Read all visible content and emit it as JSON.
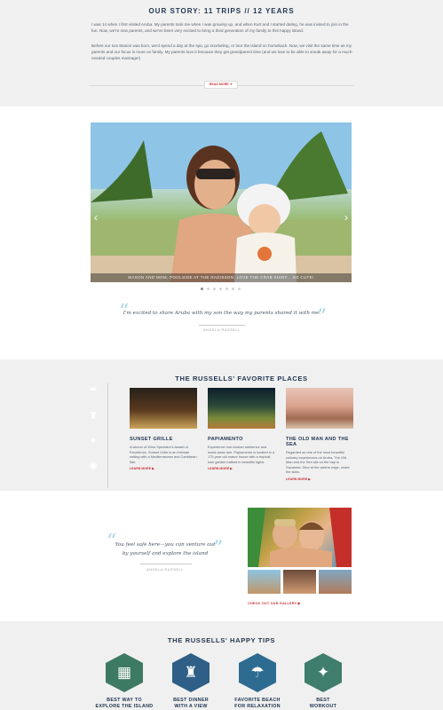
{
  "story": {
    "title": "OUR STORY:  11 TRIPS // 12 YEARS",
    "para1": "I was 14 when I first visited Aruba. My parents took me when I was growing up, and when Kurt and I started dating, he was invited to join in the fun. Now, we're new parents, and we've been very excited to bring a third generation of my family to this happy island.",
    "para2": "Before our son Mason was born, we'd spend a day at the spa, go snorkeling, or tour the island on horseback. Now, we visit the same time as my parents and our focus is more on family. My parents love it because they get grandparent time (and we love to be able to sneak away for a much-needed couples massage!)",
    "read_more": "READ MORE ▼"
  },
  "gallery": {
    "caption": "MASON AND MOM, POOLSIDE AT THE RADISSON. LOVE THE CRAB SHIRT... SO CUTE!",
    "prev_icon": "‹",
    "next_icon": "›",
    "dot_count": 7,
    "active_dot": 0,
    "quote": "I'm excited to share Aruba with my son the way my parents shared it with me.",
    "attribution": "ANGELA RUSSELL"
  },
  "places": {
    "title": "THE RUSSELLS' FAVORITE PLACES",
    "icons": [
      {
        "name": "beach-umbrella-icon",
        "glyph": "☂",
        "color": "#2f6fa3"
      },
      {
        "name": "waiter-icon",
        "glyph": "♜",
        "color": "#6f8fa3"
      },
      {
        "name": "swimmer-icon",
        "glyph": "✶",
        "color": "#4f86b2"
      },
      {
        "name": "sunglasses-icon",
        "glyph": "◉",
        "color": "#7aa39a"
      }
    ],
    "cards": [
      {
        "title": "SUNSET GRILLE",
        "text": "A winner of Wine Spectator's Award of Excellence, Sunset Grille is an intimate setting with a Mediterranean and Caribbean flair.",
        "link": "LEARN MORE ▶"
      },
      {
        "title": "PAPIAMENTO",
        "text": "Experience true Aruban ambience and world-class fare.  Papiamento is located in a 175-year old manor house with a tropical, lush garden bathed in beautiful lights.",
        "link": "LEARN MORE ▶"
      },
      {
        "title": "THE OLD MAN AND THE SEA",
        "text": "Regarded as one of the most beautiful culinary experiences on Aruba, The Old Man and the Sea sits on the bay in Savaneta. Dine at the waters edge, under the stars.",
        "link": "LEARN MORE ▶"
      }
    ]
  },
  "feel": {
    "quote": "You feel safe here—you can venture out by yourself and explore the island",
    "attribution": "ANGELA RUSSELL",
    "gallery_link": "CHECK OUT OUR GALLERY ▶"
  },
  "tips": {
    "title": "THE RUSSELLS' HAPPY TIPS",
    "items": [
      {
        "icon": "map-icon",
        "glyph": "▦",
        "color": "#3d7a63",
        "line1": "BEST WAY TO",
        "line2": "EXPLORE THE ISLAND"
      },
      {
        "icon": "waiter-icon",
        "glyph": "♜",
        "color": "#2f5f86",
        "line1": "BEST DINNER",
        "line2": "WITH A VIEW"
      },
      {
        "icon": "beach-chair-icon",
        "glyph": "☂",
        "color": "#2d6c90",
        "line1": "FAVORITE BEACH",
        "line2": "FOR RELAXATION"
      },
      {
        "icon": "workout-icon",
        "glyph": "✦",
        "color": "#3f7d6c",
        "line1": "BEST",
        "line2": "WORKOUT"
      }
    ]
  }
}
